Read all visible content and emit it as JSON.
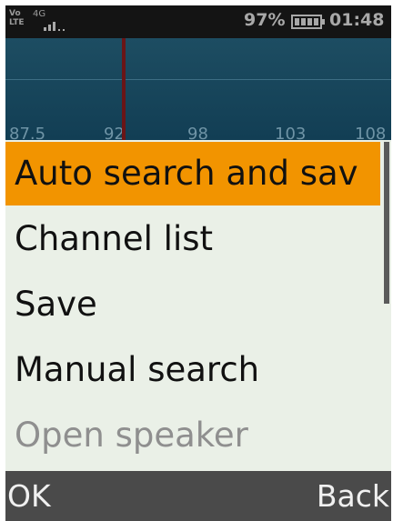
{
  "status_bar": {
    "volte": "Vo LTE",
    "network": "4G",
    "battery_percent": "97%",
    "time": "01:48"
  },
  "tuner": {
    "frequency_labels": [
      "87.5",
      "92",
      "98",
      "103",
      "108"
    ]
  },
  "menu": {
    "items": [
      {
        "label": "Auto search and sav",
        "state": "selected"
      },
      {
        "label": "Channel list",
        "state": "normal"
      },
      {
        "label": "Save",
        "state": "normal"
      },
      {
        "label": "Manual search",
        "state": "normal"
      },
      {
        "label": "Open speaker",
        "state": "disabled"
      }
    ]
  },
  "softkeys": {
    "left": "OK",
    "right": "Back"
  },
  "colors": {
    "highlight": "#f29400",
    "tuner_bg": "#1d4d62",
    "needle": "#6a1517",
    "softkey_bar": "#4a4a4a"
  }
}
